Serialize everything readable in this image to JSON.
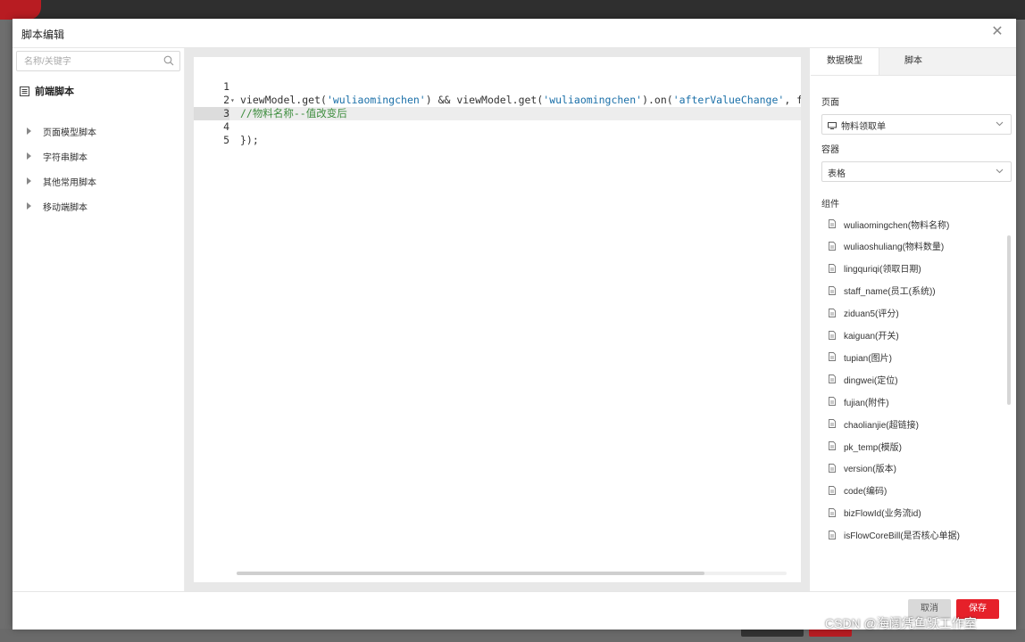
{
  "dialog": {
    "title": "脚本编辑"
  },
  "search": {
    "placeholder": "名称/关键字"
  },
  "tree": {
    "root": "前端脚本",
    "items": [
      {
        "label": "页面模型脚本"
      },
      {
        "label": "字符串脚本"
      },
      {
        "label": "其他常用脚本"
      },
      {
        "label": "移动端脚本"
      }
    ]
  },
  "editor": {
    "lines": [
      {
        "num": "1"
      },
      {
        "num": "2",
        "p1": "viewModel.get(",
        "s1": "'wuliaomingchen'",
        "p2": ") && viewModel.get(",
        "s2": "'wuliaomingchen'",
        "p3": ").on(",
        "s3": "'afterValueChange'",
        "p4": ", f"
      },
      {
        "num": "3",
        "comment": "//物料名称--值改变后"
      },
      {
        "num": "4"
      },
      {
        "num": "5",
        "text": "});"
      }
    ],
    "active_line": 3
  },
  "right": {
    "tabs": [
      {
        "label": "数据模型"
      },
      {
        "label": "脚本"
      }
    ],
    "page_label": "页面",
    "page_value": "物料领取单",
    "container_label": "容器",
    "container_value": "表格",
    "components_label": "组件",
    "components": [
      "wuliaomingchen(物料名称)",
      "wuliaoshuliang(物料数量)",
      "lingquriqi(领取日期)",
      "staff_name(员工(系统))",
      "ziduan5(评分)",
      "kaiguan(开关)",
      "tupian(图片)",
      "dingwei(定位)",
      "fujian(附件)",
      "chaolianjie(超链接)",
      "pk_temp(模版)",
      "version(版本)",
      "code(编码)",
      "bizFlowId(业务流id)",
      "isFlowCoreBill(是否核心单据)"
    ]
  },
  "footer": {
    "cancel": "取消",
    "save": "保存"
  },
  "watermark": "CSDN @海阔凭鱼跃工作室",
  "colors": {
    "accent": "#e6202a",
    "string": "#1a6fa8",
    "comment": "#3c8c3c"
  }
}
